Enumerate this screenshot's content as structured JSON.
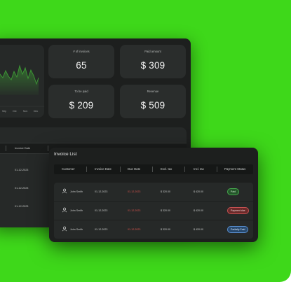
{
  "colors": {
    "background_green": "#3ed81a",
    "panel": "#1d1f1e",
    "card": "#2a2d2c",
    "chart_line": "#3a8a33",
    "due_date_red": "#e0564f"
  },
  "dashboard": {
    "chart_axis_labels": [
      "Sep",
      "Oct",
      "Nov",
      "Dec"
    ],
    "stats": [
      {
        "label": "# of invoices",
        "value": "65"
      },
      {
        "label": "Paid amount",
        "value": "$ 309"
      },
      {
        "label": "To be paid",
        "value": "$ 209"
      },
      {
        "label": "Revenue",
        "value": "$ 509"
      }
    ],
    "back_table": {
      "headers": [
        "Invoice Date"
      ],
      "dates": [
        "01-12-2023",
        "01-12-2023",
        "01-12-2023"
      ]
    }
  },
  "invoice_list": {
    "title": "Invoice List",
    "headers": [
      "Customer",
      "Invoice Date",
      "Due Date",
      "Excl. tax",
      "Incl. tax",
      "Payment Status"
    ],
    "rows": [
      {
        "customer": "John Smith",
        "invoice_date": "01-12-2023",
        "due_date": "01-12-2023",
        "excl_tax": "$ 320.00",
        "incl_tax": "$ 420.00",
        "status": "Paid",
        "status_type": "paid"
      },
      {
        "customer": "John Smith",
        "invoice_date": "01-12-2023",
        "due_date": "01-12-2023",
        "excl_tax": "$ 320.00",
        "incl_tax": "$ 420.00",
        "status": "Payment due",
        "status_type": "due"
      },
      {
        "customer": "John Smith",
        "invoice_date": "01-12-2023",
        "due_date": "01-12-2023",
        "excl_tax": "$ 320.00",
        "incl_tax": "$ 420.00",
        "status": "Partially Paid",
        "status_type": "partial"
      }
    ]
  }
}
